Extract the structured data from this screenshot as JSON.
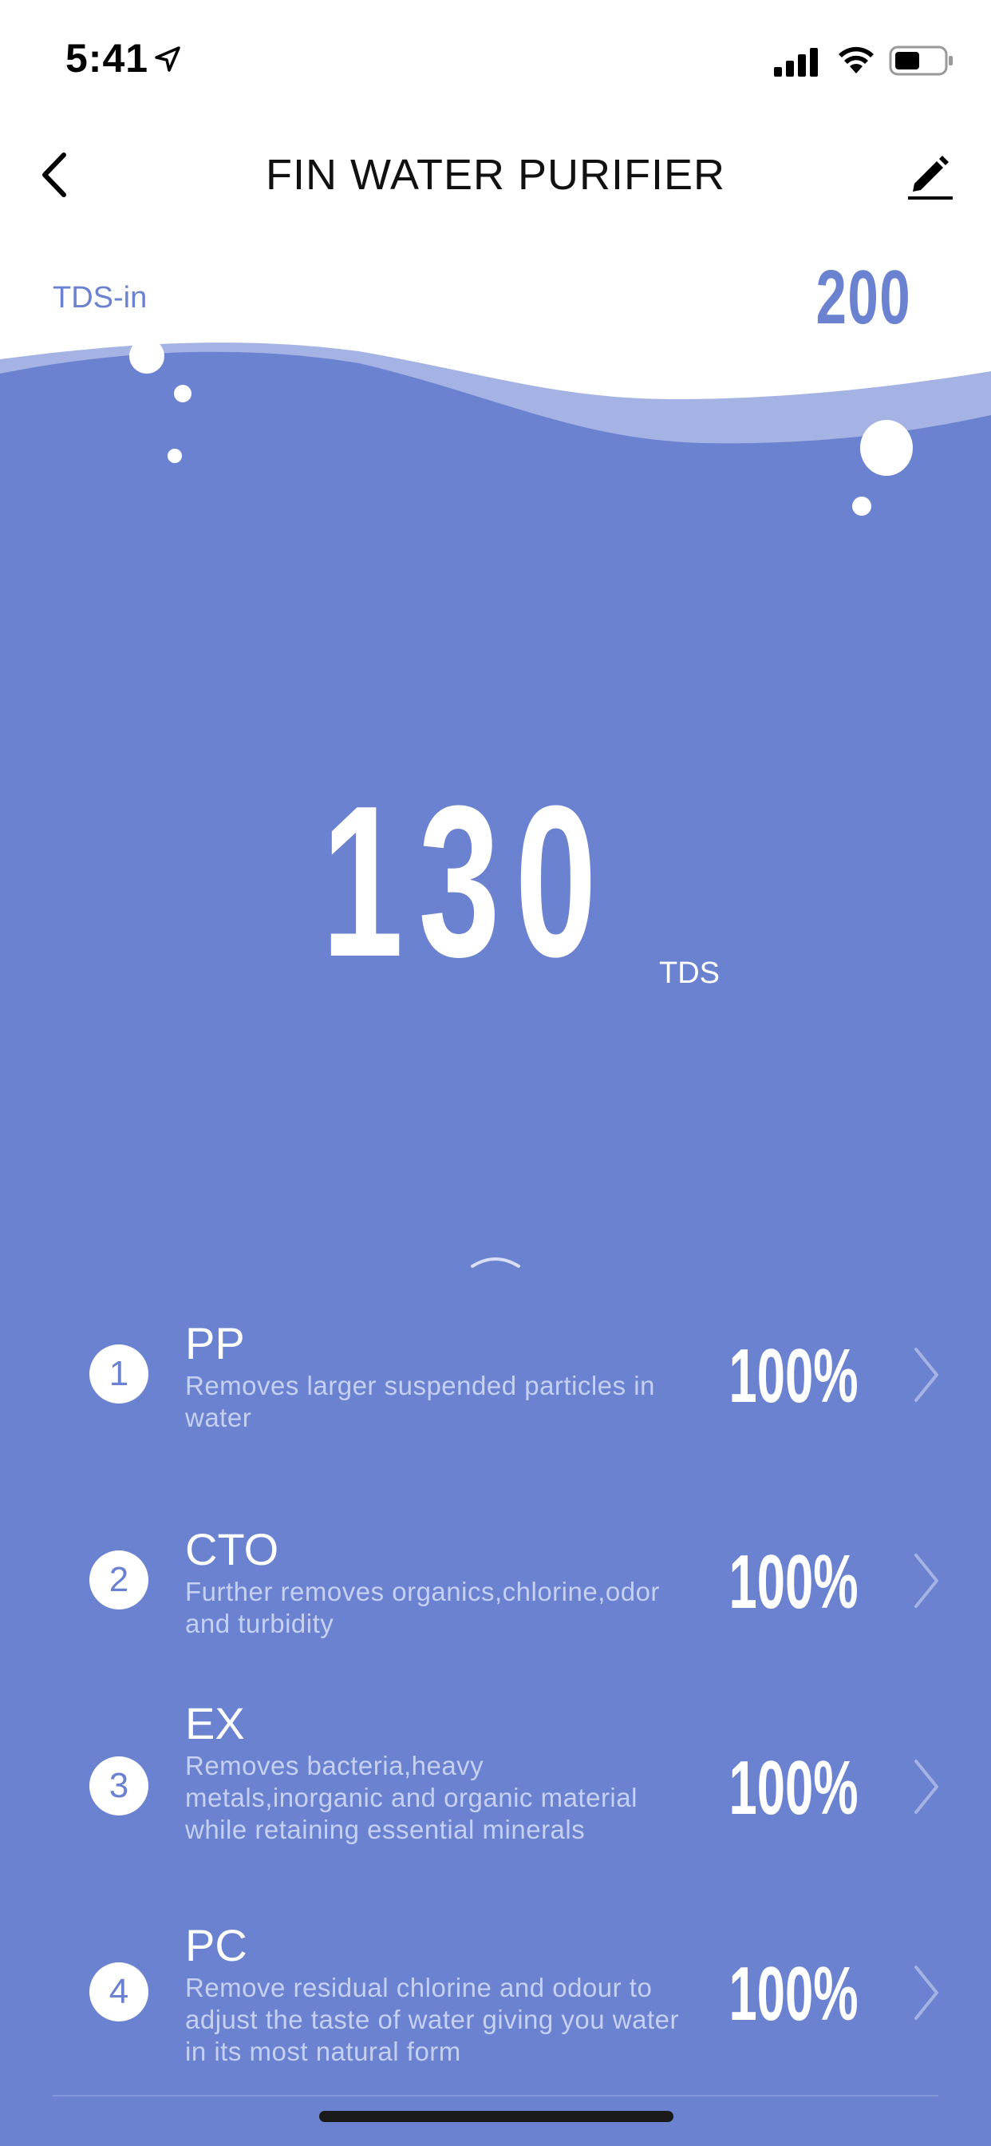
{
  "status_bar": {
    "time": "5:41"
  },
  "header": {
    "title": "FIN WATER PURIFIER"
  },
  "tds_in": {
    "label": "TDS-in",
    "value": "200"
  },
  "tds_out": {
    "value": "130",
    "unit": "TDS"
  },
  "filters": [
    {
      "number": "1",
      "name": "PP",
      "description": "Removes larger suspended particles in water",
      "percent": "100%"
    },
    {
      "number": "2",
      "name": "CTO",
      "description": "Further removes organics,chlorine,odor and turbidity",
      "percent": "100%"
    },
    {
      "number": "3",
      "name": "EX",
      "description": "Removes bacteria,heavy metals,inorganic and organic material while retaining essential minerals",
      "percent": "100%"
    },
    {
      "number": "4",
      "name": "PC",
      "description": "Remove residual chlorine and odour to adjust the taste of water giving you water in its most natural form",
      "percent": "100%"
    }
  ],
  "icons": [
    "location-arrow-icon",
    "signal-icon",
    "wifi-icon",
    "battery-icon",
    "back-arrow-icon",
    "edit-pencil-icon",
    "chevron-up-icon",
    "chevron-right-icon"
  ],
  "colors": {
    "accent": "#6a82d0",
    "wave_light": "#a4b3e3",
    "description_text": "#c6d0f0"
  }
}
